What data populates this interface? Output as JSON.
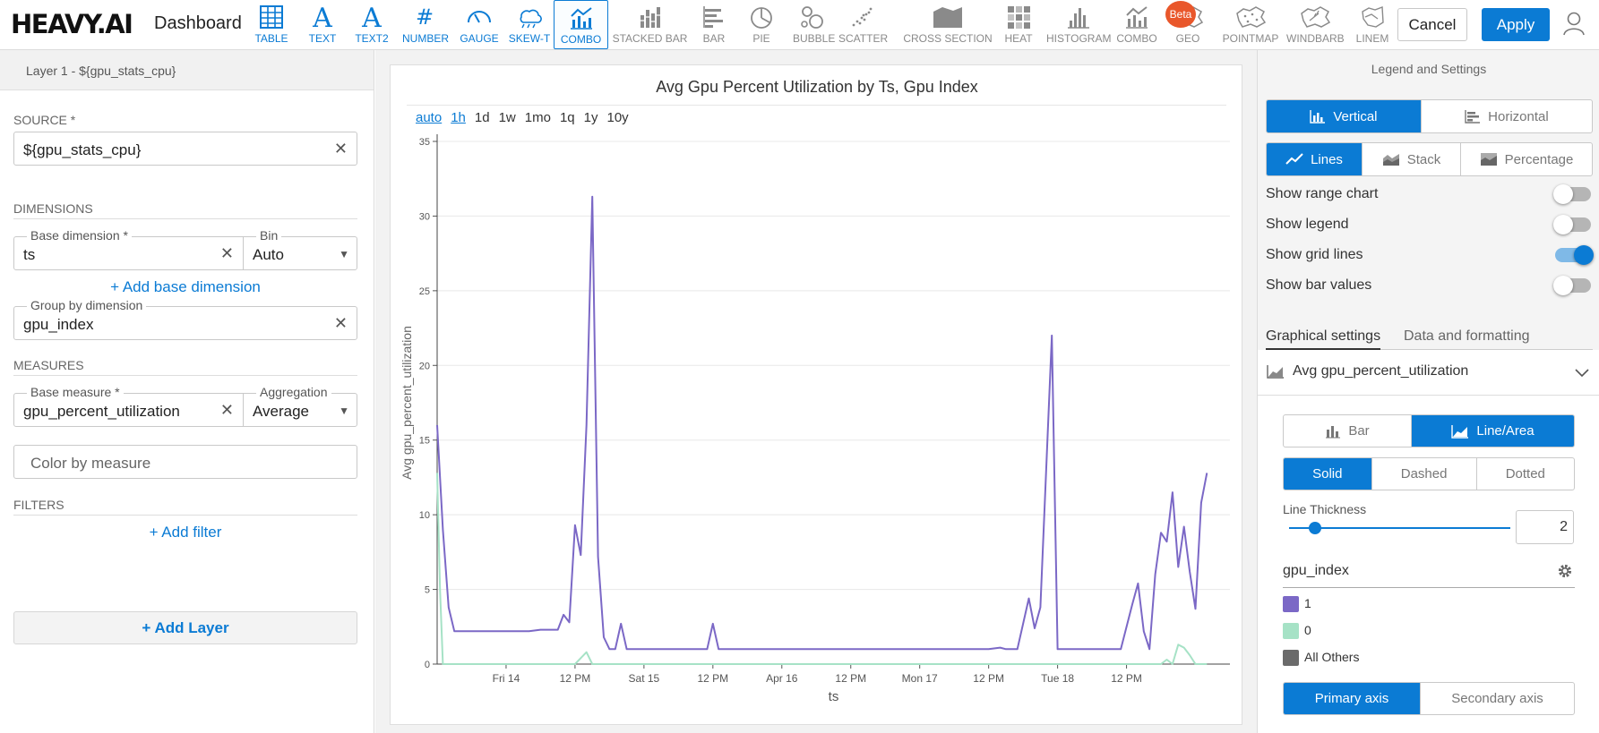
{
  "app": {
    "logo": "HEAVY.AI",
    "title": "Dashboard"
  },
  "colors": {
    "accent": "#0b7bd4",
    "series_1": "#7b68c6",
    "series_0": "#a6e2c6",
    "all_others": "#6b6b6b",
    "beta": "#e9572b"
  },
  "chart_types": [
    {
      "label": "TABLE",
      "icon": "table-icon"
    },
    {
      "label": "TEXT",
      "icon": "text-icon"
    },
    {
      "label": "TEXT2",
      "icon": "text2-icon"
    },
    {
      "label": "NUMBER",
      "icon": "hash-icon"
    },
    {
      "label": "GAUGE",
      "icon": "gauge-icon"
    },
    {
      "label": "SKEW-T",
      "icon": "skew-t-icon"
    },
    {
      "label": "COMBO",
      "icon": "combo-icon",
      "selected": true
    },
    {
      "label": "STACKED BAR",
      "icon": "stacked-bar-icon"
    },
    {
      "label": "BAR",
      "icon": "bar-icon"
    },
    {
      "label": "PIE",
      "icon": "pie-icon"
    },
    {
      "label": "BUBBLE",
      "icon": "bubble-icon"
    },
    {
      "label": "SCATTER",
      "icon": "scatter-icon"
    },
    {
      "label": "CROSS SECTION",
      "icon": "cross-section-icon"
    },
    {
      "label": "HEAT",
      "icon": "heat-icon"
    },
    {
      "label": "HISTOGRAM",
      "icon": "histogram-icon"
    },
    {
      "label": "COMBO",
      "icon": "combo-icon"
    },
    {
      "label": "GEO",
      "icon": "geo-icon"
    },
    {
      "label": "POINTMAP",
      "icon": "pointmap-icon"
    },
    {
      "label": "WINDBARB",
      "icon": "windbarb-icon"
    },
    {
      "label": "LINEM",
      "icon": "linemap-icon"
    }
  ],
  "beta_label": "Beta",
  "actions": {
    "cancel": "Cancel",
    "apply": "Apply"
  },
  "left": {
    "layer": "Layer 1 - ${gpu_stats_cpu}",
    "source_title": "SOURCE *",
    "source_value": "${gpu_stats_cpu}",
    "dimensions_title": "DIMENSIONS",
    "base_dimension_label": "Base dimension *",
    "base_dimension_value": "ts",
    "bin_label": "Bin",
    "bin_value": "Auto",
    "add_base_dimension": "+ Add base dimension",
    "group_by_label": "Group by dimension",
    "group_by_value": "gpu_index",
    "measures_title": "MEASURES",
    "base_measure_label": "Base measure *",
    "base_measure_value": "gpu_percent_utilization",
    "aggregation_label": "Aggregation",
    "aggregation_value": "Average",
    "color_by_placeholder": "Color by measure",
    "filters_title": "FILTERS",
    "add_filter": "+ Add filter",
    "add_layer": "+ Add Layer"
  },
  "bins": [
    "auto",
    "1h",
    "1d",
    "1w",
    "1mo",
    "1q",
    "1y",
    "10y"
  ],
  "chart_data": {
    "type": "line",
    "title": "Avg Gpu Percent Utilization by Ts, Gpu Index",
    "xlabel": "ts",
    "ylabel": "Avg gpu_percent_utilization",
    "ylim": [
      0,
      35
    ],
    "yticks": [
      0,
      5,
      10,
      15,
      20,
      25,
      30,
      35
    ],
    "xlim_hours": [
      0,
      138
    ],
    "xticks": [
      {
        "label": "Fri 14",
        "hour": 12
      },
      {
        "label": "12 PM",
        "hour": 24
      },
      {
        "label": "Sat 15",
        "hour": 36
      },
      {
        "label": "12 PM",
        "hour": 48
      },
      {
        "label": "Apr 16",
        "hour": 60
      },
      {
        "label": "12 PM",
        "hour": 72
      },
      {
        "label": "Mon 17",
        "hour": 84
      },
      {
        "label": "12 PM",
        "hour": 96
      },
      {
        "label": "Tue 18",
        "hour": 108
      },
      {
        "label": "12 PM",
        "hour": 120
      }
    ],
    "grid": true,
    "series": [
      {
        "name": "1",
        "points": [
          [
            0,
            16
          ],
          [
            1,
            9
          ],
          [
            2,
            3.8
          ],
          [
            3,
            2.2
          ],
          [
            5,
            2.2
          ],
          [
            8,
            2.2
          ],
          [
            12,
            2.2
          ],
          [
            16,
            2.2
          ],
          [
            18,
            2.3
          ],
          [
            21,
            2.3
          ],
          [
            22,
            3.3
          ],
          [
            23,
            2.8
          ],
          [
            24,
            9.3
          ],
          [
            25,
            7.3
          ],
          [
            26,
            16
          ],
          [
            27,
            31.3
          ],
          [
            28,
            7.2
          ],
          [
            29,
            1.8
          ],
          [
            30,
            1
          ],
          [
            31,
            1
          ],
          [
            32,
            2.7
          ],
          [
            33,
            1
          ],
          [
            36,
            1
          ],
          [
            40,
            1
          ],
          [
            44,
            1
          ],
          [
            47,
            1
          ],
          [
            48,
            2.7
          ],
          [
            49,
            1
          ],
          [
            52,
            1
          ],
          [
            60,
            1
          ],
          [
            68,
            1
          ],
          [
            76,
            1
          ],
          [
            84,
            1
          ],
          [
            92,
            1
          ],
          [
            96,
            1
          ],
          [
            98,
            1.1
          ],
          [
            99,
            1
          ],
          [
            101,
            1
          ],
          [
            103,
            4.4
          ],
          [
            104,
            2.4
          ],
          [
            105,
            3.8
          ],
          [
            107,
            22
          ],
          [
            108,
            1
          ],
          [
            110,
            1
          ],
          [
            114,
            1
          ],
          [
            118,
            1
          ],
          [
            119,
            1
          ],
          [
            121,
            4
          ],
          [
            122,
            5.4
          ],
          [
            123,
            2.2
          ],
          [
            124,
            1
          ],
          [
            125,
            6
          ],
          [
            126,
            8.8
          ],
          [
            127,
            8.2
          ],
          [
            128,
            11.5
          ],
          [
            129,
            6.5
          ],
          [
            130,
            9.2
          ],
          [
            131,
            6.2
          ],
          [
            132,
            3.7
          ],
          [
            133,
            10.8
          ],
          [
            134,
            12.8
          ]
        ]
      },
      {
        "name": "0",
        "points": [
          [
            0,
            12.8
          ],
          [
            0.5,
            5
          ],
          [
            1,
            0
          ],
          [
            5,
            0
          ],
          [
            10,
            0
          ],
          [
            20,
            0
          ],
          [
            24,
            0
          ],
          [
            25,
            0.4
          ],
          [
            26,
            0.8
          ],
          [
            27,
            0
          ],
          [
            40,
            0
          ],
          [
            60,
            0
          ],
          [
            80,
            0
          ],
          [
            100,
            0
          ],
          [
            120,
            0
          ],
          [
            126,
            0
          ],
          [
            127,
            0.3
          ],
          [
            128,
            0
          ],
          [
            129,
            1.3
          ],
          [
            130,
            1.1
          ],
          [
            131,
            0.6
          ],
          [
            132,
            0
          ],
          [
            134,
            0
          ]
        ]
      }
    ]
  },
  "right": {
    "title": "Legend and Settings",
    "orientation": [
      {
        "label": "Vertical",
        "on": true
      },
      {
        "label": "Horizontal"
      }
    ],
    "mode": [
      {
        "label": "Lines",
        "on": true
      },
      {
        "label": "Stack"
      },
      {
        "label": "Percentage"
      }
    ],
    "toggles": [
      {
        "label": "Show range chart",
        "on": false
      },
      {
        "label": "Show legend",
        "on": false
      },
      {
        "label": "Show grid lines",
        "on": true
      },
      {
        "label": "Show bar values",
        "on": false
      }
    ],
    "tabs": {
      "graphical": "Graphical settings",
      "data": "Data and formatting"
    },
    "measure": "Avg gpu_percent_utilization",
    "mark_type": [
      {
        "label": "Bar"
      },
      {
        "label": "Line/Area",
        "on": true
      }
    ],
    "line_style": [
      {
        "label": "Solid",
        "on": true
      },
      {
        "label": "Dashed"
      },
      {
        "label": "Dotted"
      }
    ],
    "line_thickness_label": "Line Thickness",
    "line_thickness": "2",
    "group_label": "gpu_index",
    "legend": [
      {
        "label": "1",
        "color": "#7b68c6"
      },
      {
        "label": "0",
        "color": "#a6e2c6"
      },
      {
        "label": "All Others",
        "color": "#6b6b6b"
      }
    ],
    "axis": [
      {
        "label": "Primary axis",
        "on": true
      },
      {
        "label": "Secondary axis"
      }
    ]
  }
}
